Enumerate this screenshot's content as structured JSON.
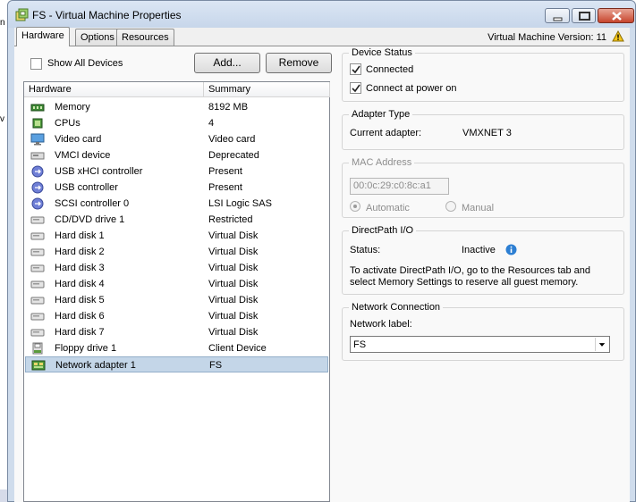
{
  "background": {
    "left_chars": [
      "n",
      "v"
    ]
  },
  "window": {
    "title": "FS - Virtual Machine Properties"
  },
  "tabs": [
    {
      "label": "Hardware",
      "active": true
    },
    {
      "label": "Options",
      "active": false
    },
    {
      "label": "Resources",
      "active": false
    }
  ],
  "vm_version": "Virtual Machine Version: 11",
  "toolbar": {
    "show_all_devices": "Show All Devices",
    "show_all_checked": false,
    "add_label": "Add...",
    "remove_label": "Remove"
  },
  "hardware_list": {
    "columns": [
      "Hardware",
      "Summary"
    ],
    "rows": [
      {
        "name": "Memory",
        "summary": "8192 MB",
        "icon": "memory-icon"
      },
      {
        "name": "CPUs",
        "summary": "4",
        "icon": "cpu-icon"
      },
      {
        "name": "Video card",
        "summary": "Video card",
        "icon": "video-card-icon"
      },
      {
        "name": "VMCI device",
        "summary": "Deprecated",
        "icon": "vmci-icon"
      },
      {
        "name": "USB xHCI controller",
        "summary": "Present",
        "icon": "usb-icon"
      },
      {
        "name": "USB controller",
        "summary": "Present",
        "icon": "usb-icon"
      },
      {
        "name": "SCSI controller 0",
        "summary": "LSI Logic SAS",
        "icon": "scsi-icon"
      },
      {
        "name": "CD/DVD drive 1",
        "summary": "Restricted",
        "icon": "cd-drive-icon"
      },
      {
        "name": "Hard disk 1",
        "summary": "Virtual Disk",
        "icon": "hard-disk-icon"
      },
      {
        "name": "Hard disk 2",
        "summary": "Virtual Disk",
        "icon": "hard-disk-icon"
      },
      {
        "name": "Hard disk 3",
        "summary": "Virtual Disk",
        "icon": "hard-disk-icon"
      },
      {
        "name": "Hard disk 4",
        "summary": "Virtual Disk",
        "icon": "hard-disk-icon"
      },
      {
        "name": "Hard disk 5",
        "summary": "Virtual Disk",
        "icon": "hard-disk-icon"
      },
      {
        "name": "Hard disk 6",
        "summary": "Virtual Disk",
        "icon": "hard-disk-icon"
      },
      {
        "name": "Hard disk 7",
        "summary": "Virtual Disk",
        "icon": "hard-disk-icon"
      },
      {
        "name": "Floppy drive 1",
        "summary": "Client Device",
        "icon": "floppy-icon"
      },
      {
        "name": "Network adapter 1",
        "summary": "FS",
        "icon": "network-adapter-icon",
        "selected": true
      }
    ]
  },
  "device_status": {
    "title": "Device Status",
    "connected_label": "Connected",
    "connected_checked": true,
    "connect_power_on_label": "Connect at power on",
    "connect_power_on_checked": true
  },
  "adapter_type": {
    "title": "Adapter Type",
    "current_label": "Current adapter:",
    "current_value": "VMXNET 3"
  },
  "mac_address": {
    "title": "MAC Address",
    "value": "00:0c:29:c0:8c:a1",
    "automatic_label": "Automatic",
    "manual_label": "Manual",
    "selected": "Automatic"
  },
  "directpath": {
    "title": "DirectPath I/O",
    "status_label": "Status:",
    "status_value": "Inactive",
    "description_line1": "To activate DirectPath I/O, go to the Resources tab and",
    "description_line2": "select Memory Settings to reserve all guest memory."
  },
  "network_connection": {
    "title": "Network Connection",
    "label": "Network label:",
    "value": "FS"
  },
  "colors": {
    "selection": "#c4d6e8",
    "title_bar": "#cfdcec",
    "close_button": "#c7452d"
  }
}
